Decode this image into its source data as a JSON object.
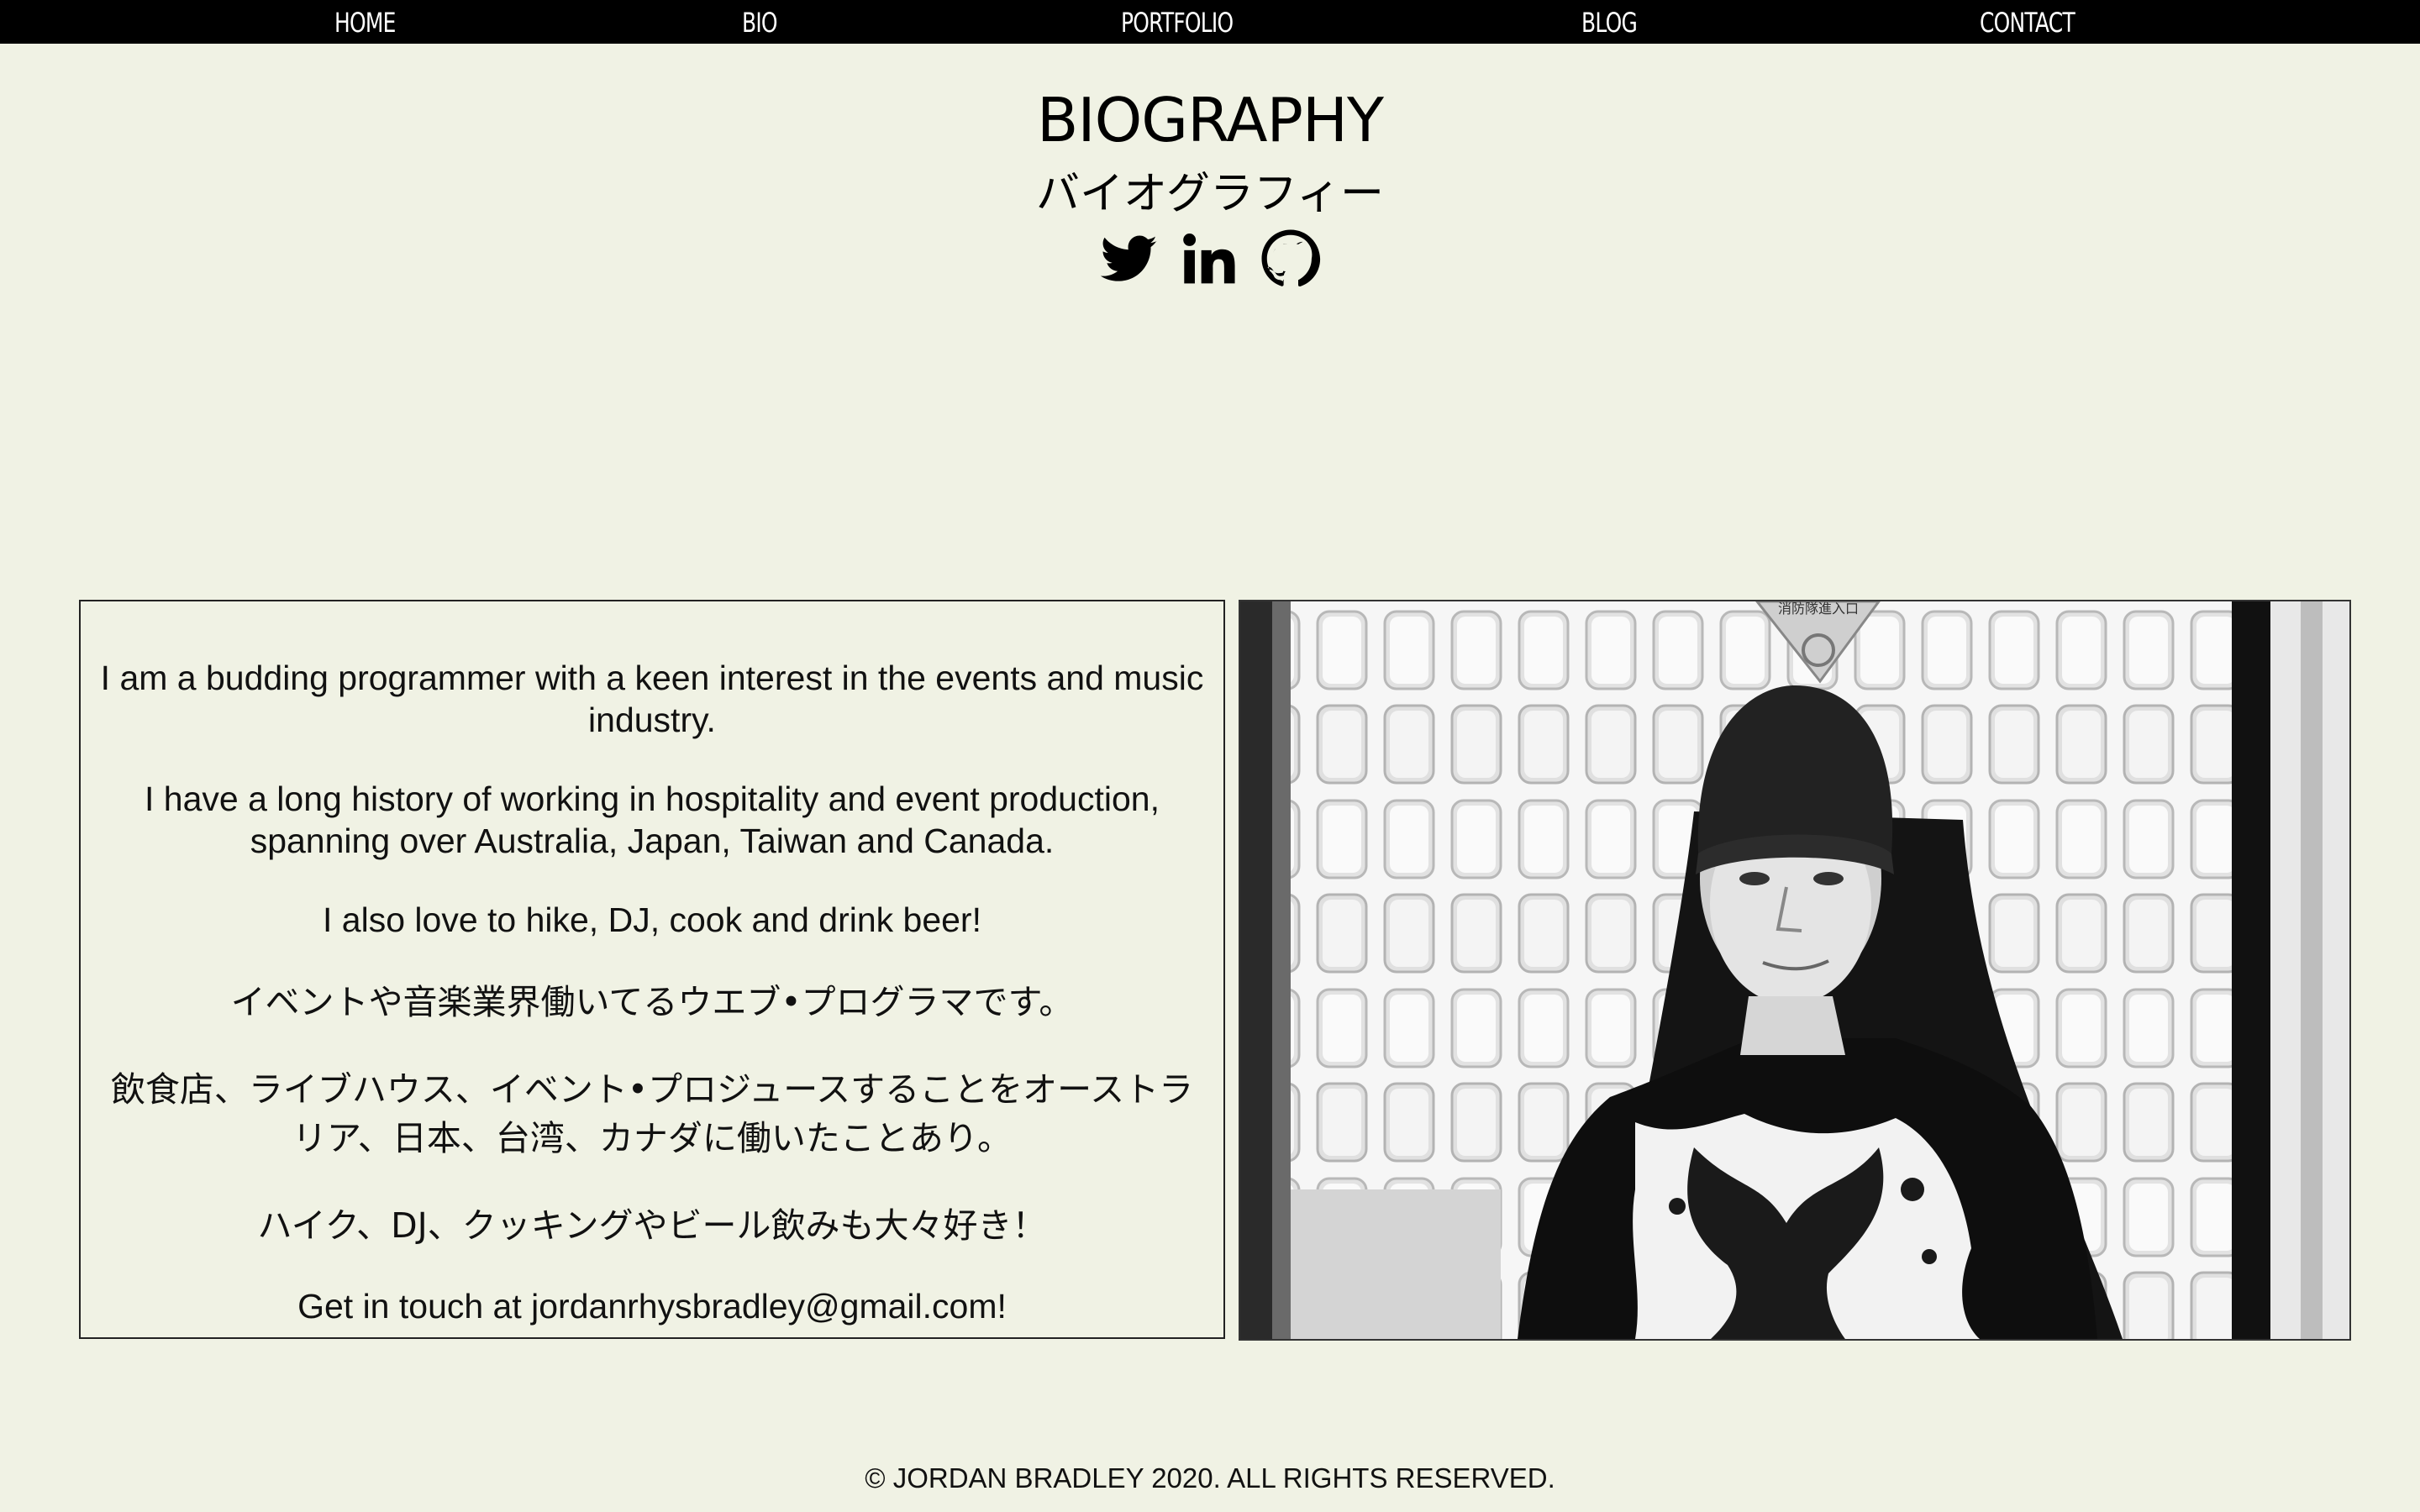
{
  "nav": {
    "home": "HOME",
    "bio": "BIO",
    "portfolio": "PORTFOLIO",
    "blog": "BLOG",
    "contact": "CONTACT"
  },
  "header": {
    "title": "BIOGRAPHY",
    "subtitle": "バイオグラフィー",
    "social_icons": [
      "twitter-icon",
      "linkedin-icon",
      "github-icon"
    ]
  },
  "bio": {
    "p1": "I am a budding programmer with a keen interest in the events and music industry.",
    "p2": "I have a long history of working in hospitality and event production, spanning over Australia, Japan, Taiwan and Canada.",
    "p3": "I also love to hike, DJ, cook and drink beer!",
    "p4": "イベントや音楽業界働いてるウエブ•プログラマです。",
    "p5": "飲食店、ライブハウス、イベント•プロジュースすることをオーストラリア、日本、台湾、カナダに働いたことあり。",
    "p6": "ハイク、DJ、クッキングやビール飲みも大々好き！",
    "p7": "Get in touch at jordanrhysbradley@gmail.com!"
  },
  "photo": {
    "sign_text": "消防隊進入口"
  },
  "footer": {
    "copyright": "© JORDAN BRADLEY 2020. ALL RIGHTS RESERVED."
  },
  "colors": {
    "background": "#f0f2e4",
    "nav_background": "#000000",
    "nav_text": "#ffffff",
    "text": "#000000"
  }
}
